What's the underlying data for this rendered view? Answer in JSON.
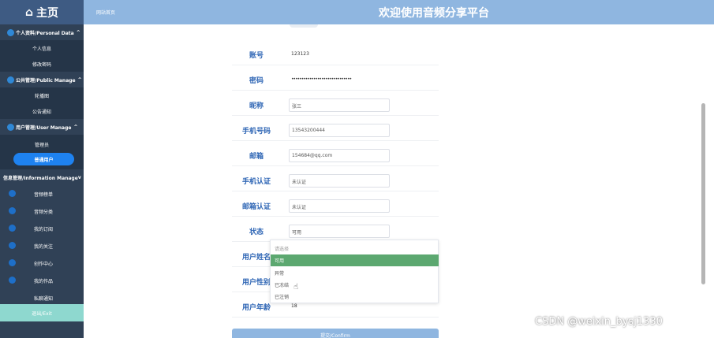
{
  "header": {
    "brand": "主页",
    "brand_icon": "home-icon",
    "site_link": "网站首页",
    "title": "欢迎使用音频分享平台"
  },
  "sidebar": {
    "groups": [
      {
        "label": "个人资料/Personal Data",
        "chevron": "^",
        "items": [
          "个人信息",
          "修改密码"
        ]
      },
      {
        "label": "公共管理/Public Manage",
        "chevron": "^",
        "items": [
          "轮播图",
          "公告通知"
        ]
      },
      {
        "label": "用户管理/User Manage",
        "chevron": "^",
        "items": [
          "管理员",
          "普通用户"
        ]
      }
    ],
    "active_item": "普通用户",
    "info_group": {
      "label": "信息管理/Information Manage",
      "chevron": "v"
    },
    "info_items": [
      "音频榜单",
      "音频分类",
      "我的订阅",
      "我的关注",
      "创作中心",
      "我的作品",
      "私聊通知"
    ],
    "logout": "退出/Exit"
  },
  "form": {
    "account": {
      "label": "账号",
      "value": "123123"
    },
    "password": {
      "label": "密码",
      "value": "••••••••••••••••••••••••••••••"
    },
    "nickname": {
      "label": "昵称",
      "value": "张三"
    },
    "phone": {
      "label": "手机号码",
      "value": "13543200444"
    },
    "email": {
      "label": "邮箱",
      "value": "154684@qq.com"
    },
    "phone_verify": {
      "label": "手机认证",
      "value": "未认证"
    },
    "email_verify": {
      "label": "邮箱认证",
      "value": "未认证"
    },
    "status": {
      "label": "状态",
      "value": "可用"
    },
    "user_name": {
      "label": "用户姓名"
    },
    "user_gender": {
      "label": "用户性别"
    },
    "user_age": {
      "label": "用户年龄",
      "value": "18"
    },
    "submit_label": "提交/Confirm"
  },
  "status_dropdown": {
    "placeholder": "请选择",
    "options": [
      "可用",
      "异常",
      "已冻结",
      "已注销"
    ],
    "selected": "可用"
  },
  "watermark": "CSDN @weixin_bysj1330",
  "colors": {
    "header": "#8fb6e0",
    "sidebar": "#304156",
    "accent": "#1e82f0",
    "label": "#2f66b5",
    "selected_option": "#5ca870"
  }
}
